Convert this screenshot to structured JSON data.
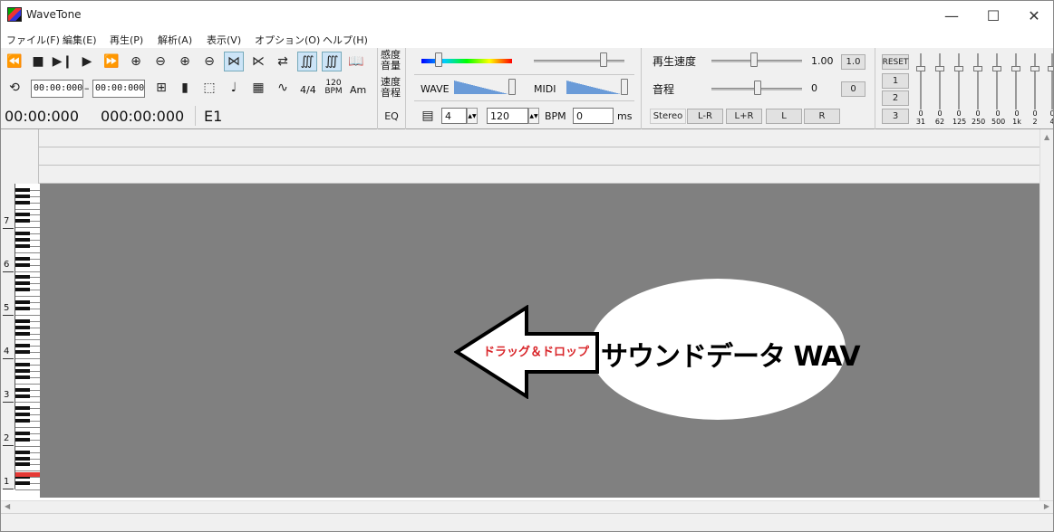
{
  "window": {
    "title": "WaveTone",
    "minimize": "—",
    "maximize": "☐",
    "close": "✕"
  },
  "menu": [
    "ファイル(F)",
    "編集(E)",
    "再生(P)",
    "解析(A)",
    "表示(V)",
    "オプション(O)",
    "ヘルプ(H)"
  ],
  "toolbar": {
    "range_start": "00:00:000",
    "range_sep": "–",
    "range_end": "00:00:000",
    "time_signature": "4/4",
    "bpm_icon_top": "120",
    "bpm_icon_bottom": "BPM",
    "chord_icon": "Am",
    "current_time": "00:00:000",
    "total_time": "000:00:000",
    "note_name": "E1"
  },
  "sensitivity": {
    "label_top": "感度",
    "label_bottom": "音量",
    "speed_label_top": "速度",
    "speed_label_bottom": "音程",
    "eq_label": "EQ",
    "wave_label": "WAVE",
    "midi_label": "MIDI",
    "beats_value": "4",
    "bpm_value": "120",
    "bpm_label": "BPM",
    "ms_value": "0",
    "ms_label": "ms"
  },
  "playback": {
    "speed_label": "再生速度",
    "speed_value": "1.00",
    "speed_reset": "1.0",
    "pitch_label": "音程",
    "pitch_value": "0",
    "pitch_reset": "0",
    "channels": [
      "Stereo",
      "L-R",
      "L+R",
      "L",
      "R"
    ]
  },
  "eq": {
    "reset_label": "RESET",
    "presets": [
      "1",
      "2",
      "3"
    ],
    "band_values": [
      "0",
      "0",
      "0",
      "0",
      "0",
      "0",
      "0",
      "0"
    ],
    "band_freqs": [
      "31",
      "62",
      "125",
      "250",
      "500",
      "1k",
      "2",
      "4"
    ]
  },
  "piano": {
    "octaves": [
      "7",
      "6",
      "5",
      "4",
      "3",
      "2",
      "1"
    ]
  },
  "overlay": {
    "drop_label": "サウンドデータ WAV",
    "arrow_label": "ドラッグ＆ドロップ"
  },
  "colors": {
    "plot_bg": "#808080",
    "arrow_text": "#d9262a",
    "highlight_key": "#e53935"
  }
}
